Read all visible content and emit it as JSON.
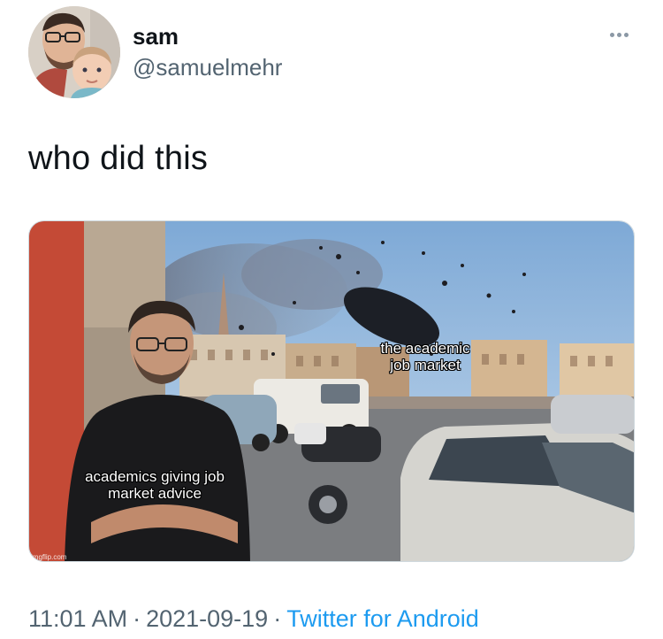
{
  "user": {
    "display_name": "sam",
    "handle": "@samuelmehr"
  },
  "tweet": {
    "text": "who did this"
  },
  "media": {
    "caption_top": "the academic job market",
    "caption_bottom": "academics giving job market advice",
    "watermark": "imgflip.com"
  },
  "meta": {
    "time": "11:01 AM",
    "separator": "·",
    "date": "2021-09-19",
    "source": "Twitter for Android"
  },
  "colors": {
    "text_primary": "#0f1419",
    "text_secondary": "#536471",
    "link": "#1d9bf0"
  },
  "icons": {
    "more": "more-horizontal-icon"
  }
}
